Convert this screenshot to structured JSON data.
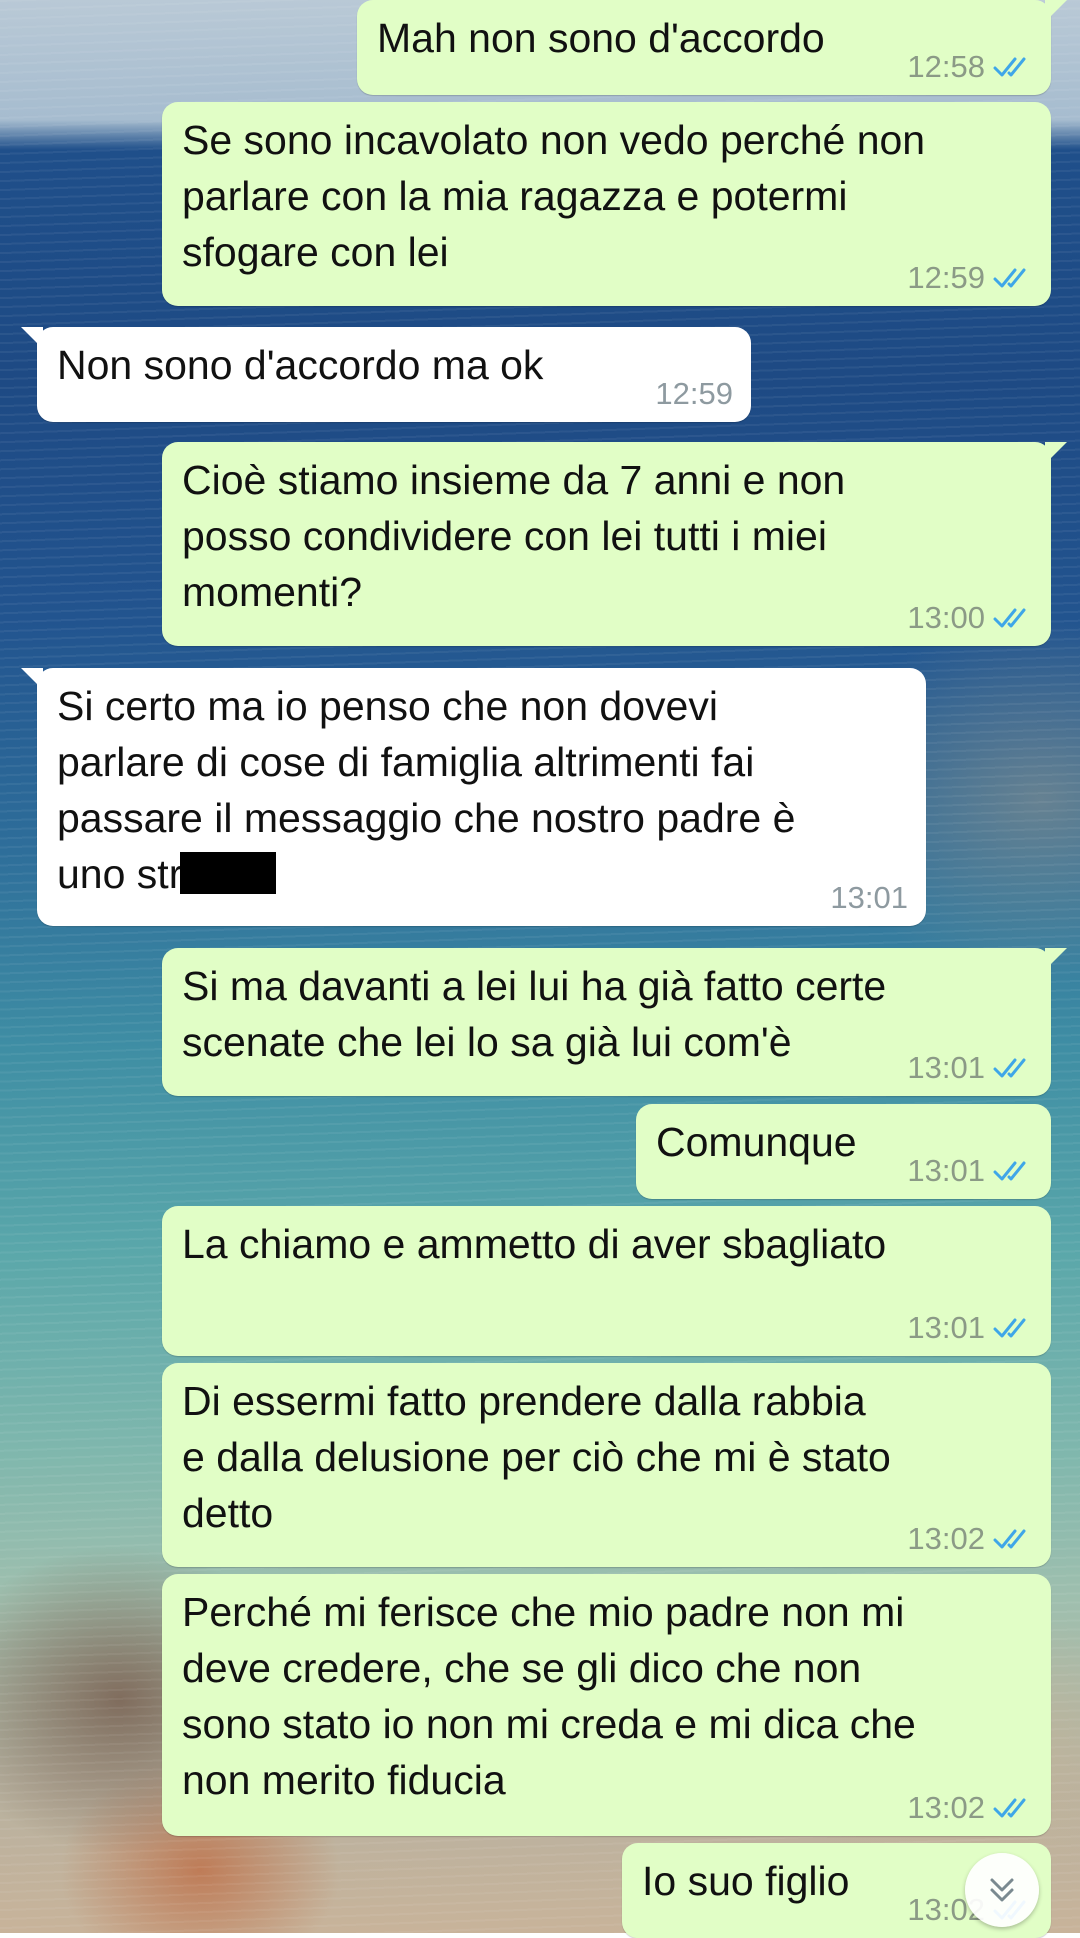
{
  "messages": [
    {
      "text": "Mah non sono d'accordo",
      "time": "12:58",
      "direction": "outgoing",
      "status": "read"
    },
    {
      "text": "Se sono incavolato non vedo perché non\nparlare con la mia ragazza e potermi\nsfogare con lei",
      "time": "12:59",
      "direction": "outgoing",
      "status": "read"
    },
    {
      "text": "Non sono d'accordo ma ok",
      "time": "12:59",
      "direction": "incoming"
    },
    {
      "text": "Cioè stiamo insieme da 7 anni e non\nposso condividere con lei tutti i miei\nmomenti?",
      "time": "13:00",
      "direction": "outgoing",
      "status": "read"
    },
    {
      "text": "Si certo ma io penso che non dovevi\nparlare di cose di famiglia altrimenti fai\npassare il messaggio che nostro padre è\nuno str",
      "time": "13:01",
      "direction": "incoming",
      "redacted_tail": true
    },
    {
      "text": "Si ma davanti a lei lui ha già fatto certe\nscenate che lei lo sa già lui com'è",
      "time": "13:01",
      "direction": "outgoing",
      "status": "read"
    },
    {
      "text": "Comunque",
      "time": "13:01",
      "direction": "outgoing",
      "status": "read"
    },
    {
      "text": "La chiamo e ammetto di aver sbagliato",
      "time": "13:01",
      "direction": "outgoing",
      "status": "read"
    },
    {
      "text": "Di essermi fatto prendere dalla rabbia\ne dalla delusione per ciò che mi è stato\ndetto",
      "time": "13:02",
      "direction": "outgoing",
      "status": "read"
    },
    {
      "text": "Perché mi ferisce che mio padre non mi\ndeve credere, che se gli dico che non\nsono stato io non mi creda e mi dica che\nnon merito fiducia",
      "time": "13:02",
      "direction": "outgoing",
      "status": "read"
    },
    {
      "text": "Io suo figlio",
      "time": "13:02",
      "direction": "outgoing",
      "status": "read"
    }
  ],
  "icons": {
    "read_receipt": "double-check-icon",
    "scroll_down": "double-chevron-down-icon"
  },
  "colors": {
    "outgoing_bubble": "#e1fec6",
    "incoming_bubble": "#ffffff",
    "read_ticks": "#3fa6e8"
  }
}
